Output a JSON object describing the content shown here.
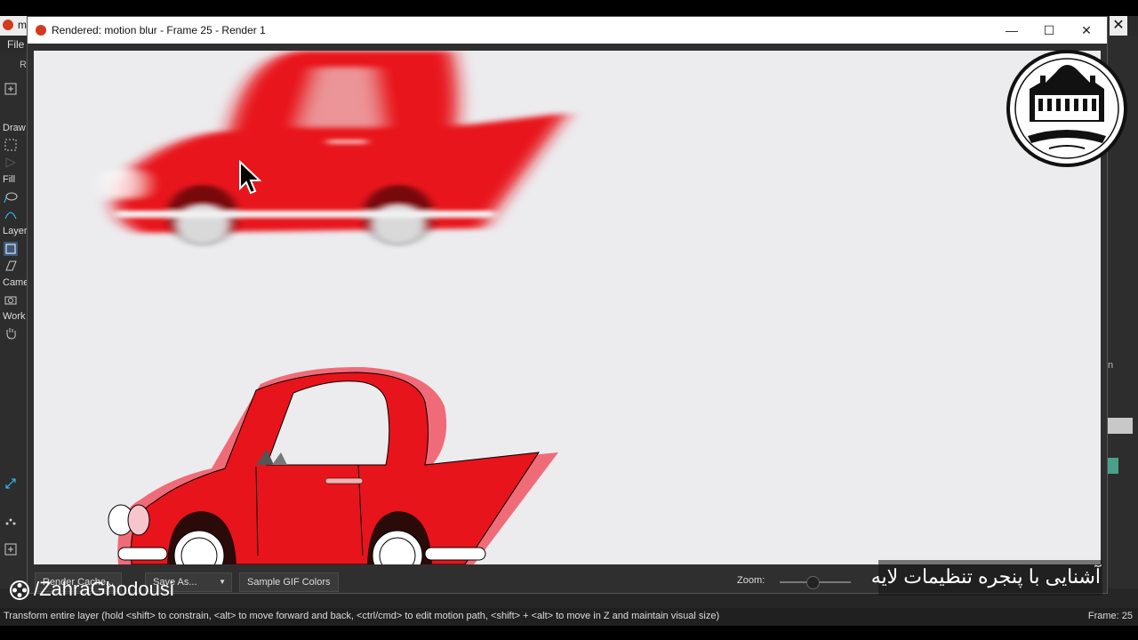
{
  "background_app": {
    "app_letter": "m",
    "menu_file": "File",
    "toolbar_r": "R",
    "close_glyph": "✕",
    "left_panel": {
      "draw_label": "Draw",
      "fill_label": "Fill",
      "layer_label": "Layer",
      "camera_label": "Came",
      "workspace_label": "Work"
    },
    "right_panel_letter": "n",
    "status_text": "Transform entire layer (hold <shift> to constrain, <alt> to move forward and back, <ctrl/cmd> to edit motion path, <shift> + <alt> to move in Z and maintain visual size)",
    "frame_indicator": "Frame: 25"
  },
  "render_window": {
    "title": "Rendered: motion blur - Frame 25 - Render 1",
    "minimize_glyph": "—",
    "maximize_glyph": "☐",
    "close_glyph": "✕",
    "buttons": {
      "render_cache": "Render Cache...",
      "save_as": "Save As...",
      "sample_gif": "Sample GIF Colors"
    },
    "dropdown_glyph": "▼",
    "zoom_label": "Zoom:",
    "zoom_level": 0.45,
    "car_color": "#e8141b",
    "car_outline_color": "#f06b78"
  },
  "overlays": {
    "watermark": "/ZahraGhodousi",
    "caption": "آشنایی با پنجره تنظیمات لایه"
  },
  "icons": {
    "cursor": "arrow-cursor-icon",
    "logo": "building-seal-logo",
    "watermark": "film-reel-icon"
  }
}
